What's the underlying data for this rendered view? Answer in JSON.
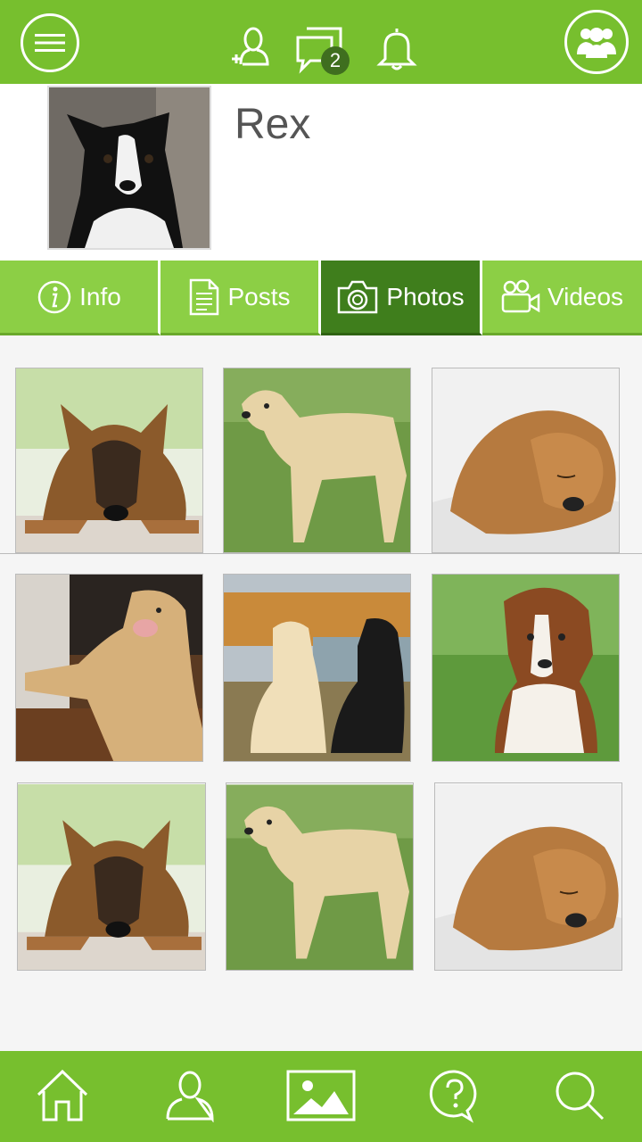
{
  "header": {
    "menu_icon": "hamburger-icon",
    "add_friend_icon": "add-user-icon",
    "messages_icon": "chat-icon",
    "messages_count": "2",
    "notifications_icon": "bell-icon",
    "groups_icon": "group-icon"
  },
  "profile": {
    "name": "Rex"
  },
  "tabs": [
    {
      "label": "Info",
      "icon": "info-icon"
    },
    {
      "label": "Posts",
      "icon": "document-icon"
    },
    {
      "label": "Photos",
      "icon": "camera-icon",
      "active": true
    },
    {
      "label": "Videos",
      "icon": "video-camera-icon"
    }
  ],
  "photos": [
    {
      "subject": "german-shepherd"
    },
    {
      "subject": "yellow-labrador"
    },
    {
      "subject": "sleeping-puppy"
    },
    {
      "subject": "labrador-at-window"
    },
    {
      "subject": "two-labradors"
    },
    {
      "subject": "beagle-puppy"
    },
    {
      "subject": "german-shepherd"
    },
    {
      "subject": "yellow-labrador"
    },
    {
      "subject": "sleeping-puppy"
    }
  ],
  "bottom_nav": [
    "home-icon",
    "profile-icon",
    "gallery-icon",
    "help-icon",
    "search-icon"
  ],
  "colors": {
    "brand_green": "#77bf2e",
    "tab_green": "#8ccf45",
    "tab_active": "#3f7e1c",
    "badge": "#3f6e1f"
  }
}
